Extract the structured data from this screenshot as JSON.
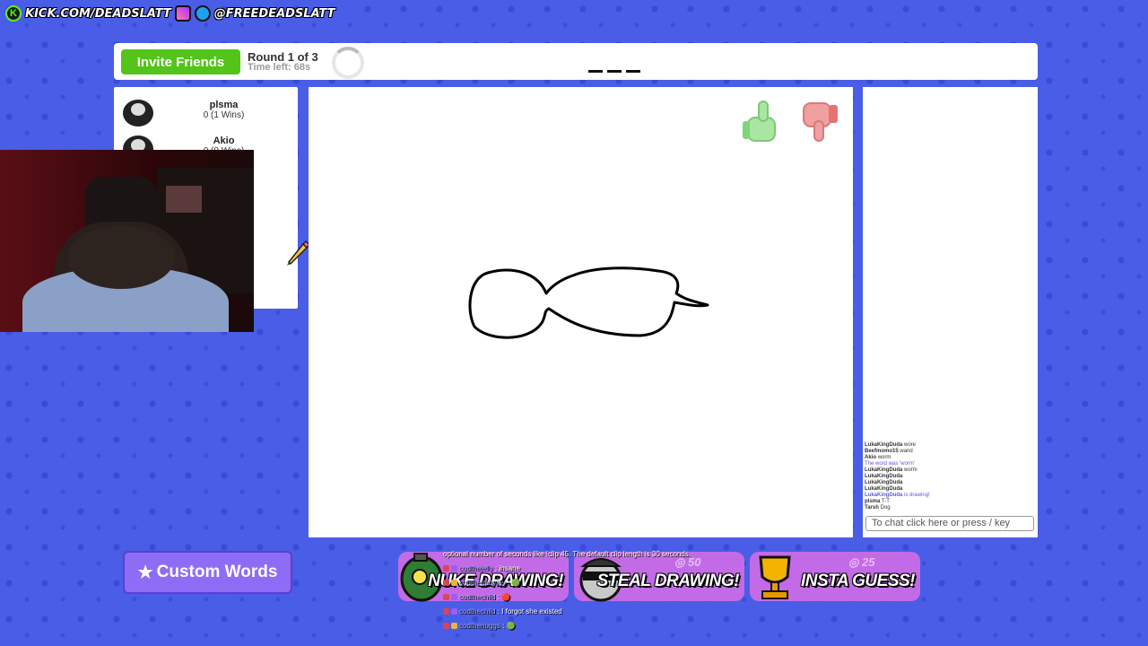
{
  "social": {
    "kick": "KICK.COM/DEADSLATT",
    "handle": "@FREEDEADSLATT"
  },
  "topbar": {
    "invite_label": "Invite Friends",
    "round": "Round 1 of 3",
    "time_left": "Time left: 68s"
  },
  "players": [
    {
      "name": "plsma",
      "score": "0 (1 Wins)"
    },
    {
      "name": "Akio",
      "score": "0 (0 Wins)"
    }
  ],
  "chat": {
    "lines": [
      {
        "user": "LukaKingDuda",
        "text": "wore"
      },
      {
        "user": "Beefmomo15",
        "text": "wand"
      },
      {
        "user": "Akio",
        "text": "worm"
      },
      {
        "user": "",
        "text": "The word was 'worm'",
        "system": true
      },
      {
        "user": "LukaKingDuda",
        "text": "worm"
      },
      {
        "user": "LukaKingDuda",
        "text": ""
      },
      {
        "user": "LukaKingDuda",
        "text": ""
      },
      {
        "user": "LukaKingDuda",
        "text": ""
      },
      {
        "user": "LukaKingDuda",
        "text": "is drawing!",
        "system": true
      },
      {
        "user": "plsma",
        "text": "T-T"
      },
      {
        "user": "Tarsh",
        "text": "Dog"
      }
    ],
    "placeholder": "To chat click here or press / key"
  },
  "custom_words_label": "Custom Words",
  "powerups": [
    {
      "label": "NUKE DRAWING!",
      "cost": "",
      "icon": "bomb-icon"
    },
    {
      "label": "STEAL DRAWING!",
      "cost": "50",
      "icon": "thief-icon"
    },
    {
      "label": "INSTA GUESS!",
      "cost": "25",
      "icon": "trophy-icon"
    }
  ],
  "stream_chat": [
    {
      "user": "",
      "text": "optional number of seconds like !clip 45. The default clip length is 30 seconds."
    },
    {
      "user": "codthejelly",
      "text": ": insane"
    },
    {
      "user": "codthebabyjay",
      "text": ":"
    },
    {
      "user": "codthechild",
      "text": ":"
    },
    {
      "user": "codthechild",
      "text": ": I forgot she existed"
    },
    {
      "user": "codthenuggs",
      "text": ":"
    }
  ],
  "colors": {
    "background": "#4a5de6",
    "invite": "#52c41a",
    "custom_words": "#8e6cf5",
    "powerup": "#c36be6"
  }
}
